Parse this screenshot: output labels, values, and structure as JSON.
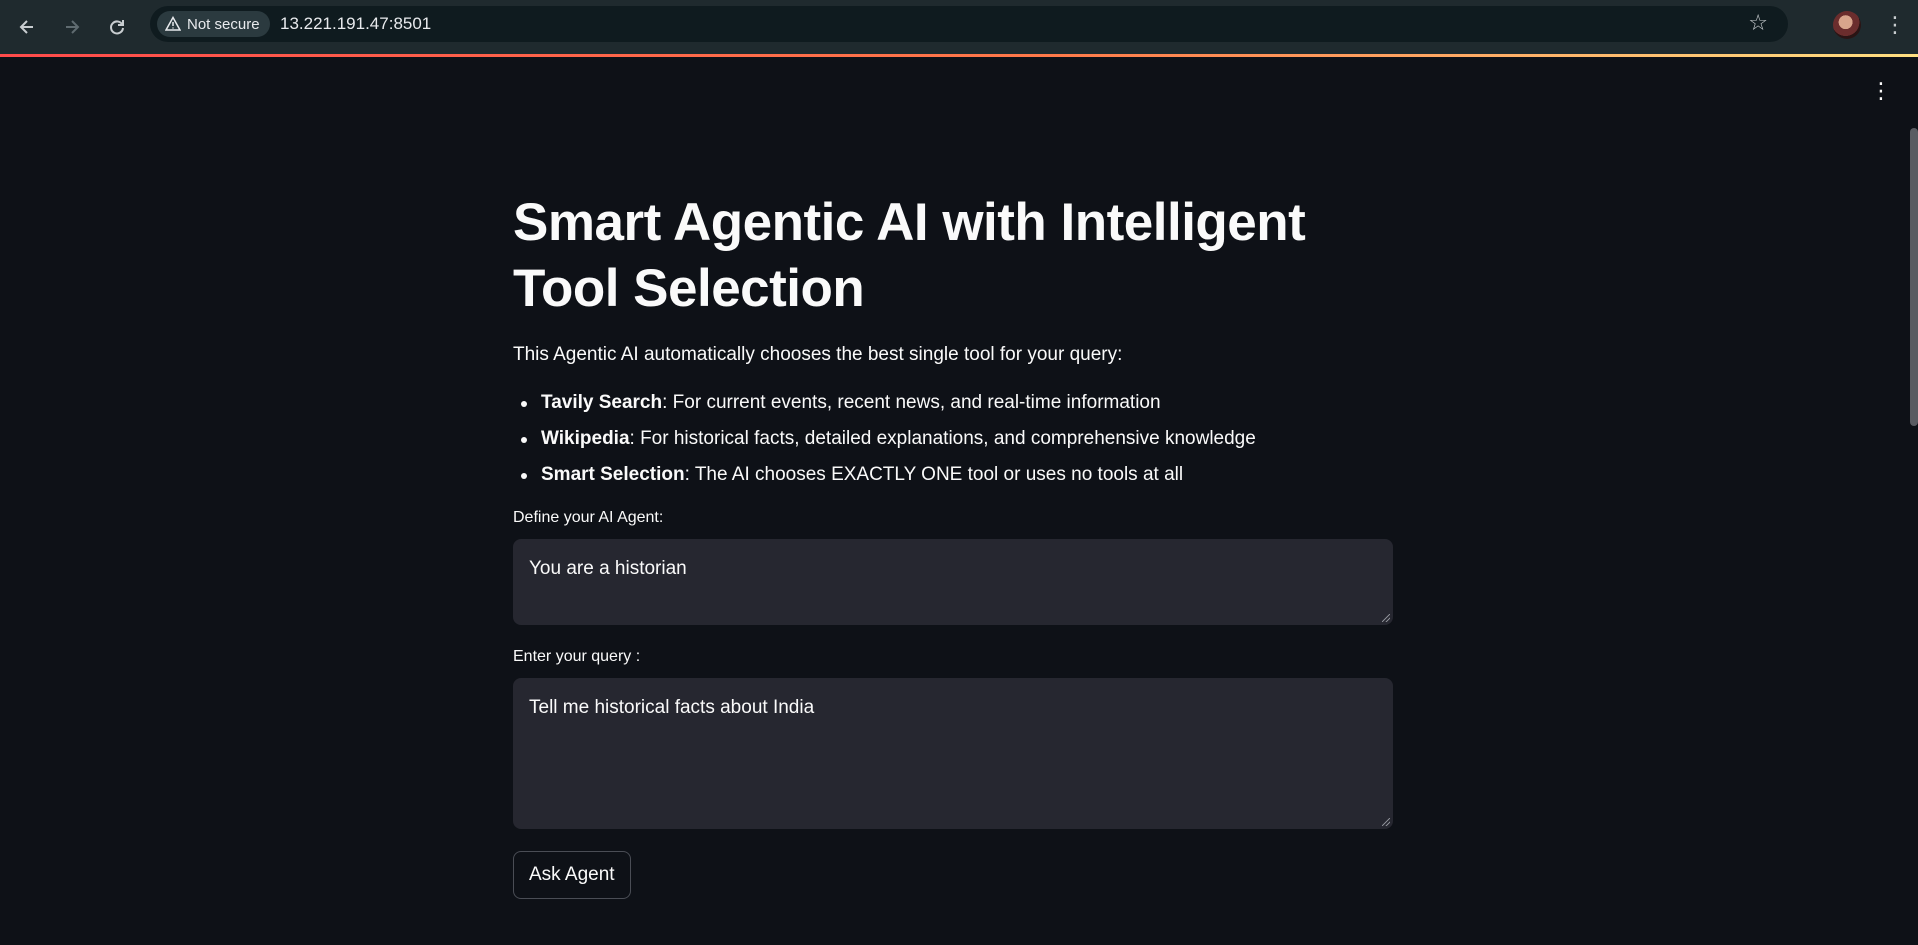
{
  "browser": {
    "back_icon": "arrow-left-icon",
    "forward_icon": "arrow-right-icon",
    "reload_icon": "reload-icon",
    "security_label": "Not secure",
    "url": "13.221.191.47:8501",
    "bookmark_icon": "star-icon",
    "menu_icon": "vertical-dots-icon"
  },
  "app": {
    "title": "Smart Agentic AI with Intelligent Tool Selection",
    "intro": "This Agentic AI automatically chooses the best single tool for your query:",
    "features": [
      {
        "name": "Tavily Search",
        "description": ": For current events, recent news, and real-time information"
      },
      {
        "name": "Wikipedia",
        "description": ": For historical facts, detailed explanations, and comprehensive knowledge"
      },
      {
        "name": "Smart Selection",
        "description": ": The AI chooses EXACTLY ONE tool or uses no tools at all"
      }
    ],
    "agent_field": {
      "label": "Define your AI Agent:",
      "value": "You are a historian"
    },
    "query_field": {
      "label": "Enter your query :",
      "value": "Tell me historical facts about India"
    },
    "submit_label": "Ask Agent"
  },
  "colors": {
    "background": "#0e1117",
    "input_background": "#262730",
    "accent_start": "#ff4b4b",
    "accent_end": "#ffe082"
  }
}
